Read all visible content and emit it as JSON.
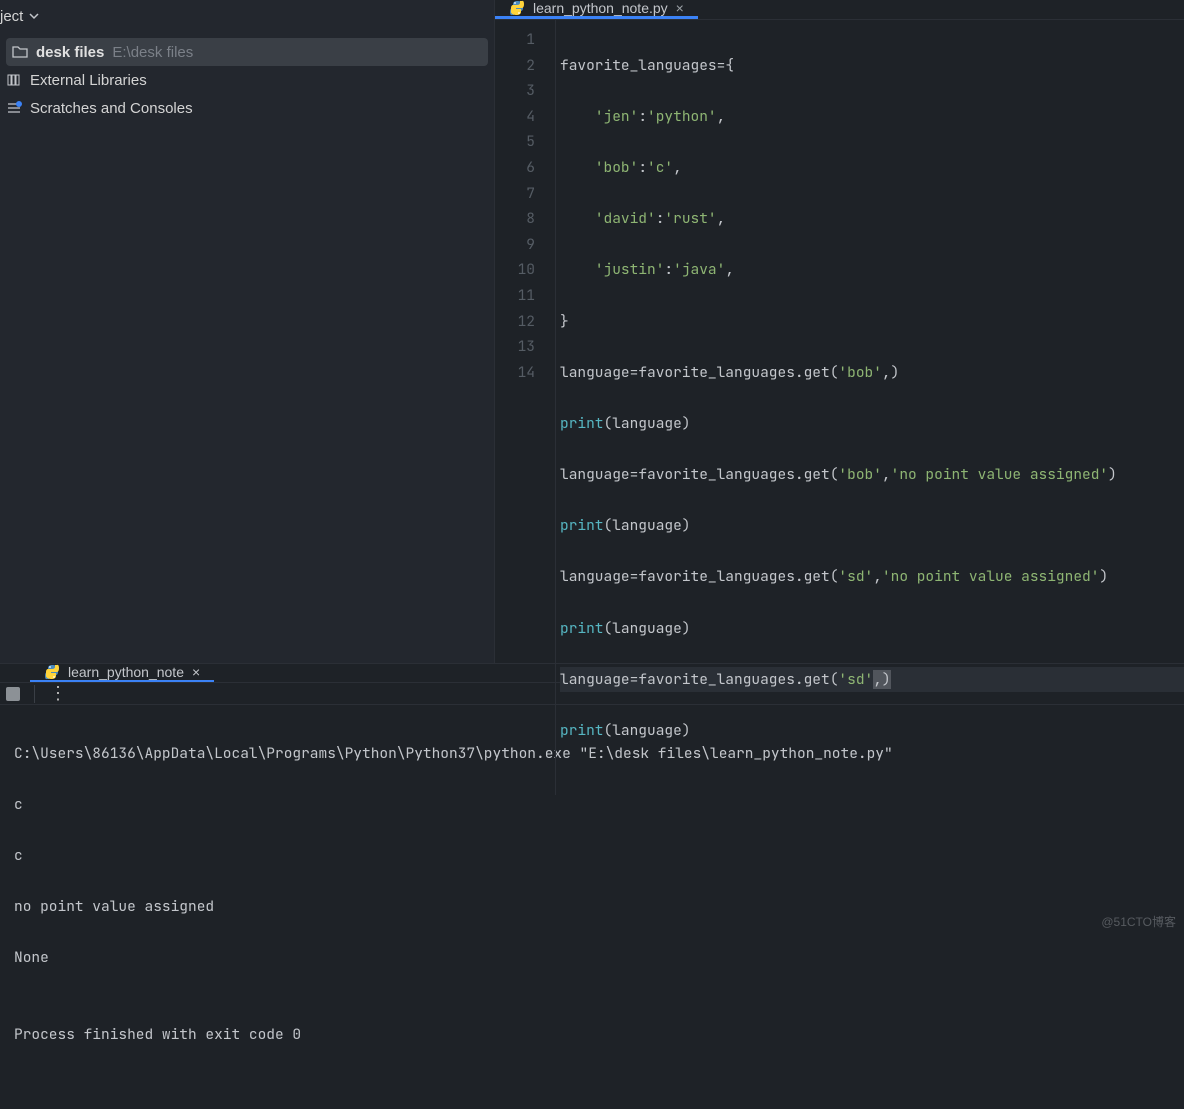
{
  "sidebar": {
    "project_label": "ject",
    "items": [
      {
        "icon": "folder",
        "label": "desk files",
        "path": "E:\\desk files",
        "bold": true,
        "selected": true
      },
      {
        "icon": "library",
        "label": "External Libraries",
        "path": "",
        "bold": false,
        "selected": false
      },
      {
        "icon": "scratch",
        "label": "Scratches and Consoles",
        "path": "",
        "bold": false,
        "selected": false
      }
    ]
  },
  "editor": {
    "tab_filename": "learn_python_note.py",
    "line_numbers": [
      "1",
      "2",
      "3",
      "4",
      "5",
      "6",
      "7",
      "8",
      "9",
      "10",
      "11",
      "12",
      "13",
      "14"
    ],
    "lines": {
      "l1": {
        "a": "favorite_languages",
        "b": "=",
        "c": "{"
      },
      "l2": {
        "indent": "    ",
        "k": "'jen'",
        "colon": ":",
        "v": "'python'",
        "comma": ","
      },
      "l3": {
        "indent": "    ",
        "k": "'bob'",
        "colon": ":",
        "v": "'c'",
        "comma": ","
      },
      "l4": {
        "indent": "    ",
        "k": "'david'",
        "colon": ":",
        "v": "'rust'",
        "comma": ","
      },
      "l5": {
        "indent": "    ",
        "k": "'justin'",
        "colon": ":",
        "v": "'java'",
        "comma": ","
      },
      "l6": {
        "a": "}"
      },
      "l7": {
        "a": "language",
        "b": "=",
        "c": "favorite_languages.get(",
        "s1": "'bob'",
        "d": ",)"
      },
      "l8": {
        "a": "print",
        "b": "(language)"
      },
      "l9": {
        "a": "language",
        "b": "=",
        "c": "favorite_languages.get(",
        "s1": "'bob'",
        "d": ",",
        "s2": "'no point value assigned'",
        "e": ")"
      },
      "l10": {
        "a": "print",
        "b": "(language)"
      },
      "l11": {
        "a": "language",
        "b": "=",
        "c": "favorite_languages.get(",
        "s1": "'sd'",
        "d": ",",
        "s2": "'no point value assigned'",
        "e": ")"
      },
      "l12": {
        "a": "print",
        "b": "(language)"
      },
      "l13": {
        "a": "language",
        "b": "=",
        "c": "favorite_languages.get(",
        "s1": "'sd'",
        "d": ",)"
      },
      "l14": {
        "a": "print",
        "b": "(language)"
      }
    }
  },
  "run": {
    "tab_name": "learn_python_note",
    "console_lines": [
      "C:\\Users\\86136\\AppData\\Local\\Programs\\Python\\Python37\\python.exe \"E:\\desk files\\learn_python_note.py\"",
      "c",
      "c",
      "no point value assigned",
      "None",
      "",
      "Process finished with exit code 0"
    ]
  },
  "watermark": "@51CTO博客"
}
